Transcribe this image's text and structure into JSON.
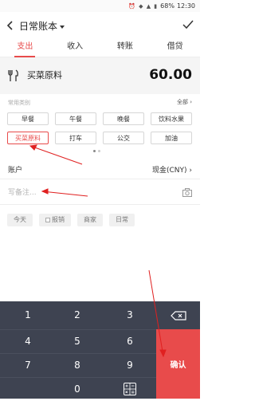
{
  "status_bar": {
    "battery": "68%",
    "time": "12:30"
  },
  "header": {
    "title": "日常账本"
  },
  "tabs": [
    {
      "label": "支出",
      "active": true
    },
    {
      "label": "收入",
      "active": false
    },
    {
      "label": "转账",
      "active": false
    },
    {
      "label": "借贷",
      "active": false
    }
  ],
  "entry": {
    "category": "买菜原料",
    "amount": "60.00"
  },
  "categories": {
    "section_label": "常用类别",
    "all_label": "全部",
    "items": [
      {
        "label": "早餐"
      },
      {
        "label": "午餐"
      },
      {
        "label": "晚餐"
      },
      {
        "label": "饮料水果"
      },
      {
        "label": "买菜原料",
        "selected": true
      },
      {
        "label": "打车"
      },
      {
        "label": "公交"
      },
      {
        "label": "加油"
      }
    ]
  },
  "account": {
    "label": "账户",
    "value": "现金(CNY)"
  },
  "note": {
    "placeholder": "写备注..."
  },
  "tags": [
    {
      "label": "今天"
    },
    {
      "label": "报销"
    },
    {
      "label": "商家"
    },
    {
      "label": "日常"
    }
  ],
  "keypad": {
    "keys": [
      "1",
      "2",
      "3",
      "4",
      "5",
      "6",
      "7",
      "8",
      "9",
      "0"
    ],
    "confirm_label": "确认"
  },
  "colors": {
    "accent": "#e84b4b",
    "keypad_bg": "#3e4351"
  }
}
